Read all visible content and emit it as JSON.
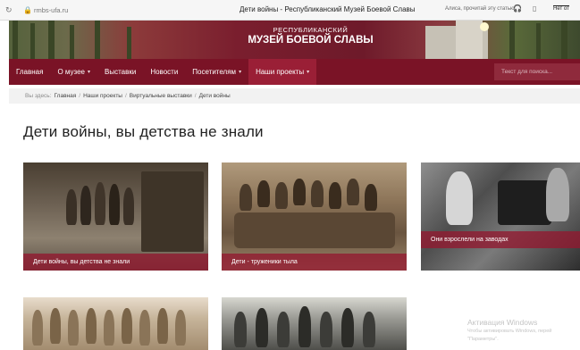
{
  "browser": {
    "reload_icon": "reload-icon",
    "lock_icon": "lock-icon",
    "url": "rmbs-ufa.ru",
    "tab_title": "Дети войны - Республиканский Музей Боевой Славы",
    "alisa_text": "Алиса, прочитай эту статью",
    "headphones_icon": "headphones-icon",
    "bookmark_icon": "bookmark-icon",
    "extension_label": "Нет от"
  },
  "banner": {
    "line1": "РЕСПУБЛИКАНСКИЙ",
    "line2": "МУЗЕЙ БОЕВОЙ СЛАВЫ"
  },
  "nav": {
    "items": [
      {
        "label": "Главная",
        "caret": false
      },
      {
        "label": "О музее",
        "caret": true
      },
      {
        "label": "Выставки",
        "caret": false
      },
      {
        "label": "Новости",
        "caret": false
      },
      {
        "label": "Посетителям",
        "caret": true
      },
      {
        "label": "Наши проекты",
        "caret": true,
        "active": true
      }
    ],
    "caret_glyph": "▾",
    "search_placeholder": "Текст для поиска..."
  },
  "breadcrumbs": {
    "prefix": "Вы здесь:",
    "items": [
      "Главная",
      "Наши проекты",
      "Виртуальные выставки",
      "Дети войны"
    ],
    "separator": "/"
  },
  "page": {
    "title": "Дети войны, вы детства не знали"
  },
  "cards": [
    {
      "caption": "Дети войны, вы детства не знали"
    },
    {
      "caption": "Дети - труженики тыла"
    },
    {
      "caption": "Они взрослели на заводах"
    },
    {
      "caption": ""
    },
    {
      "caption": ""
    }
  ],
  "watermark": {
    "line1": "Активация Windows",
    "line2": "Чтобы активировать Windows, перей",
    "line3": "\"Параметры\"."
  },
  "colors": {
    "nav_bg": "#7a1326",
    "nav_active": "#9a1f36",
    "caption_bg": "#921830"
  }
}
